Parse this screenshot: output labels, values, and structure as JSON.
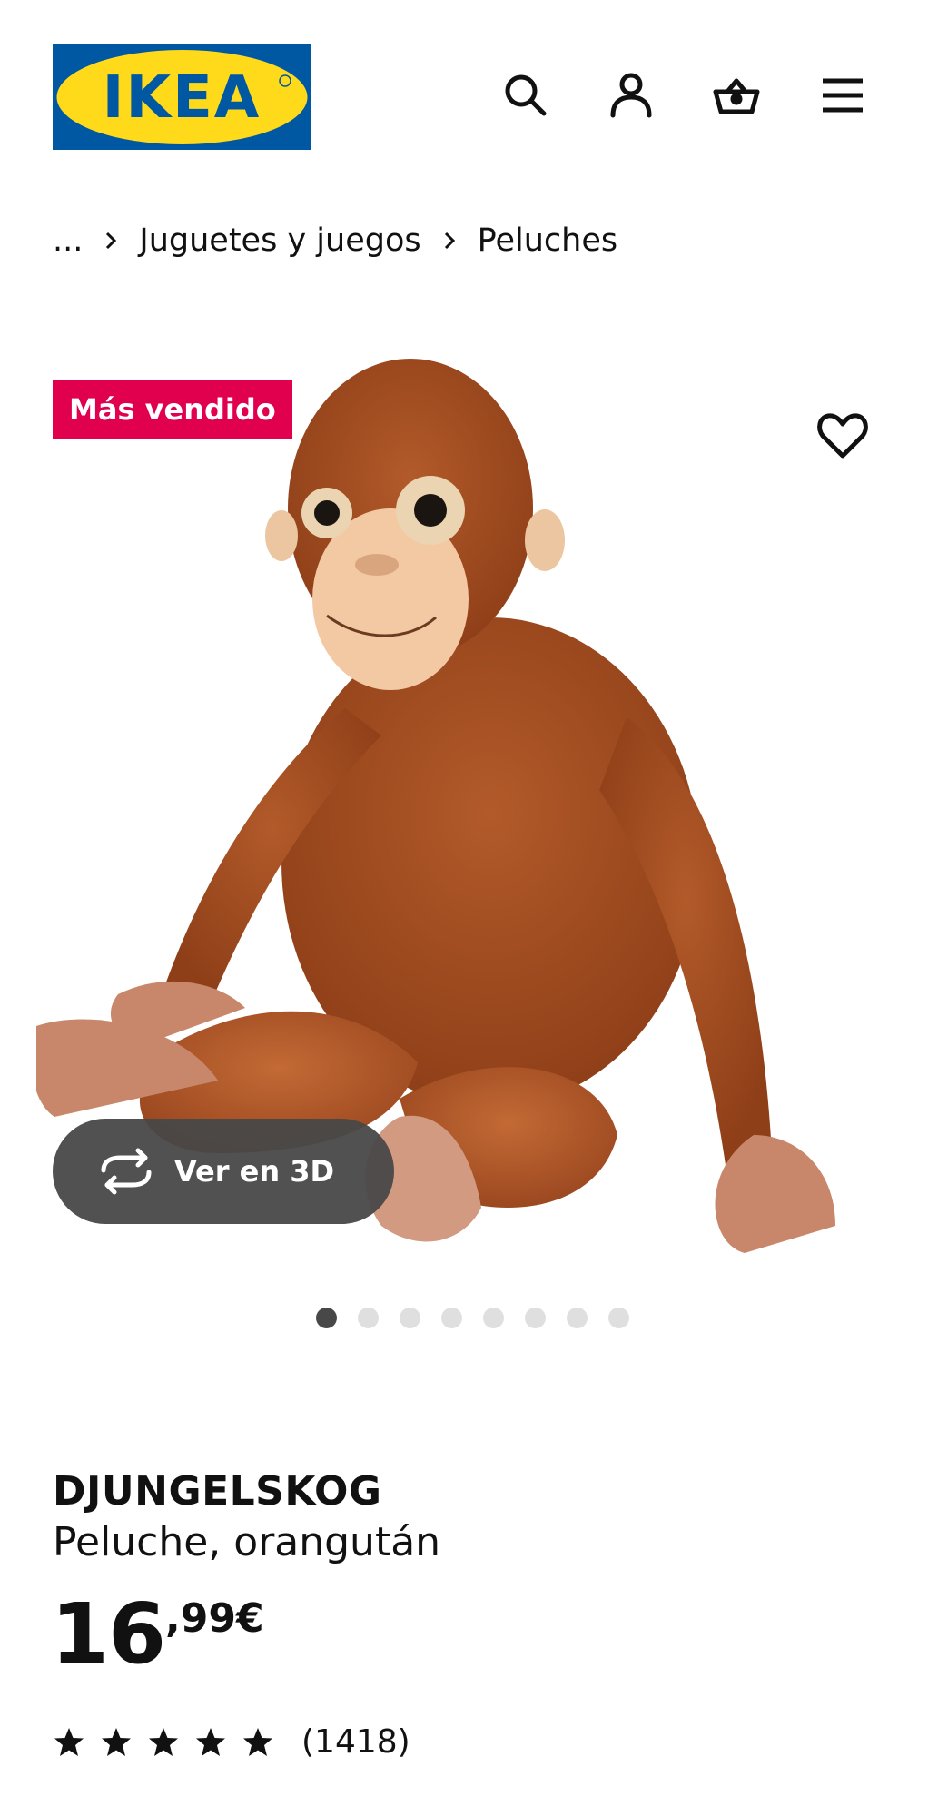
{
  "header": {
    "logo_text": "IKEA",
    "icons": [
      "search-icon",
      "account-icon",
      "cart-icon",
      "menu-icon"
    ],
    "brand_blue": "#0058a3",
    "brand_yellow": "#ffda1a"
  },
  "breadcrumb": {
    "items": [
      "...",
      "Juguetes y juegos",
      "Peluches"
    ]
  },
  "media": {
    "badge": "Más vendido",
    "badge_color": "#e0004d",
    "view_3d_label": "Ver en 3D",
    "carousel_total": 8,
    "carousel_active": 1
  },
  "product": {
    "name": "DJUNGELSKOG",
    "description": "Peluche, orangután",
    "price_integer": "16",
    "price_decimal": ",99€",
    "rating_stars": 5,
    "review_count": "(1418)"
  }
}
